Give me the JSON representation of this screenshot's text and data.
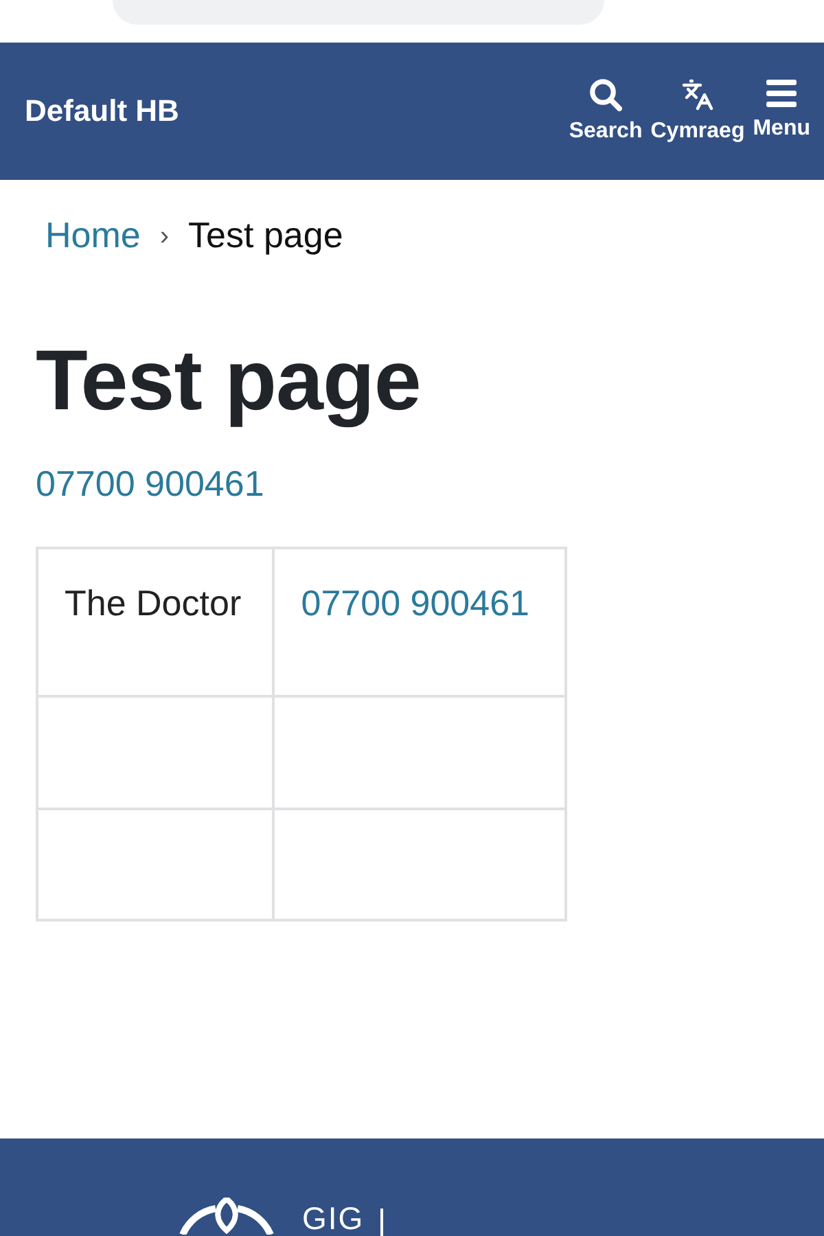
{
  "header": {
    "title": "Default HB",
    "actions": [
      {
        "kind": "search",
        "label": "Search"
      },
      {
        "kind": "language",
        "label": "Cymraeg"
      },
      {
        "kind": "menu",
        "label": "Menu"
      }
    ]
  },
  "breadcrumb": {
    "separator": "›",
    "items": [
      {
        "kind": "link",
        "label": "Home"
      },
      {
        "kind": "current",
        "label": "Test page"
      }
    ]
  },
  "page": {
    "title": "Test page",
    "phone": "07700 900461"
  },
  "table": {
    "rows": [
      {
        "cells": [
          {
            "kind": "text",
            "text": "The Doctor"
          },
          {
            "kind": "link",
            "text": "07700 900461"
          }
        ]
      },
      {
        "cells": [
          {
            "kind": "empty"
          },
          {
            "kind": "empty"
          }
        ]
      },
      {
        "cells": [
          {
            "kind": "empty"
          },
          {
            "kind": "empty"
          }
        ]
      }
    ]
  },
  "footer": {
    "logo_text": "GIG"
  }
}
